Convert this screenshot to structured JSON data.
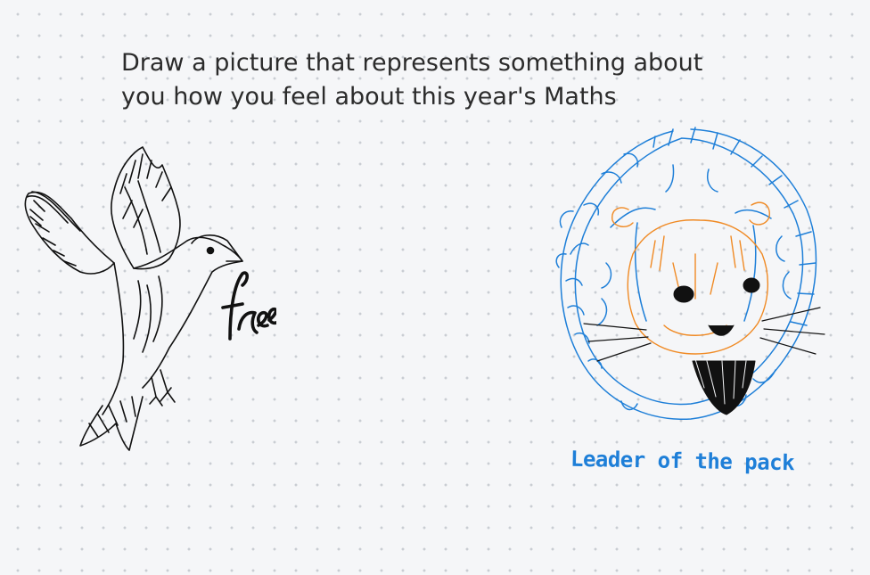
{
  "canvas": {
    "prompt_lines": [
      "Draw a picture that represents something about",
      "you how you feel about this year's Maths"
    ]
  },
  "drawings": {
    "bird": {
      "subject": "dove-sketch",
      "handwritten_word": "free",
      "ink_color": "#111111"
    },
    "lion": {
      "subject": "lion-face-sketch",
      "caption": "Leader of the pack",
      "ink_colors": [
        "#1e7fd8",
        "#f08a24",
        "#111111"
      ]
    }
  }
}
